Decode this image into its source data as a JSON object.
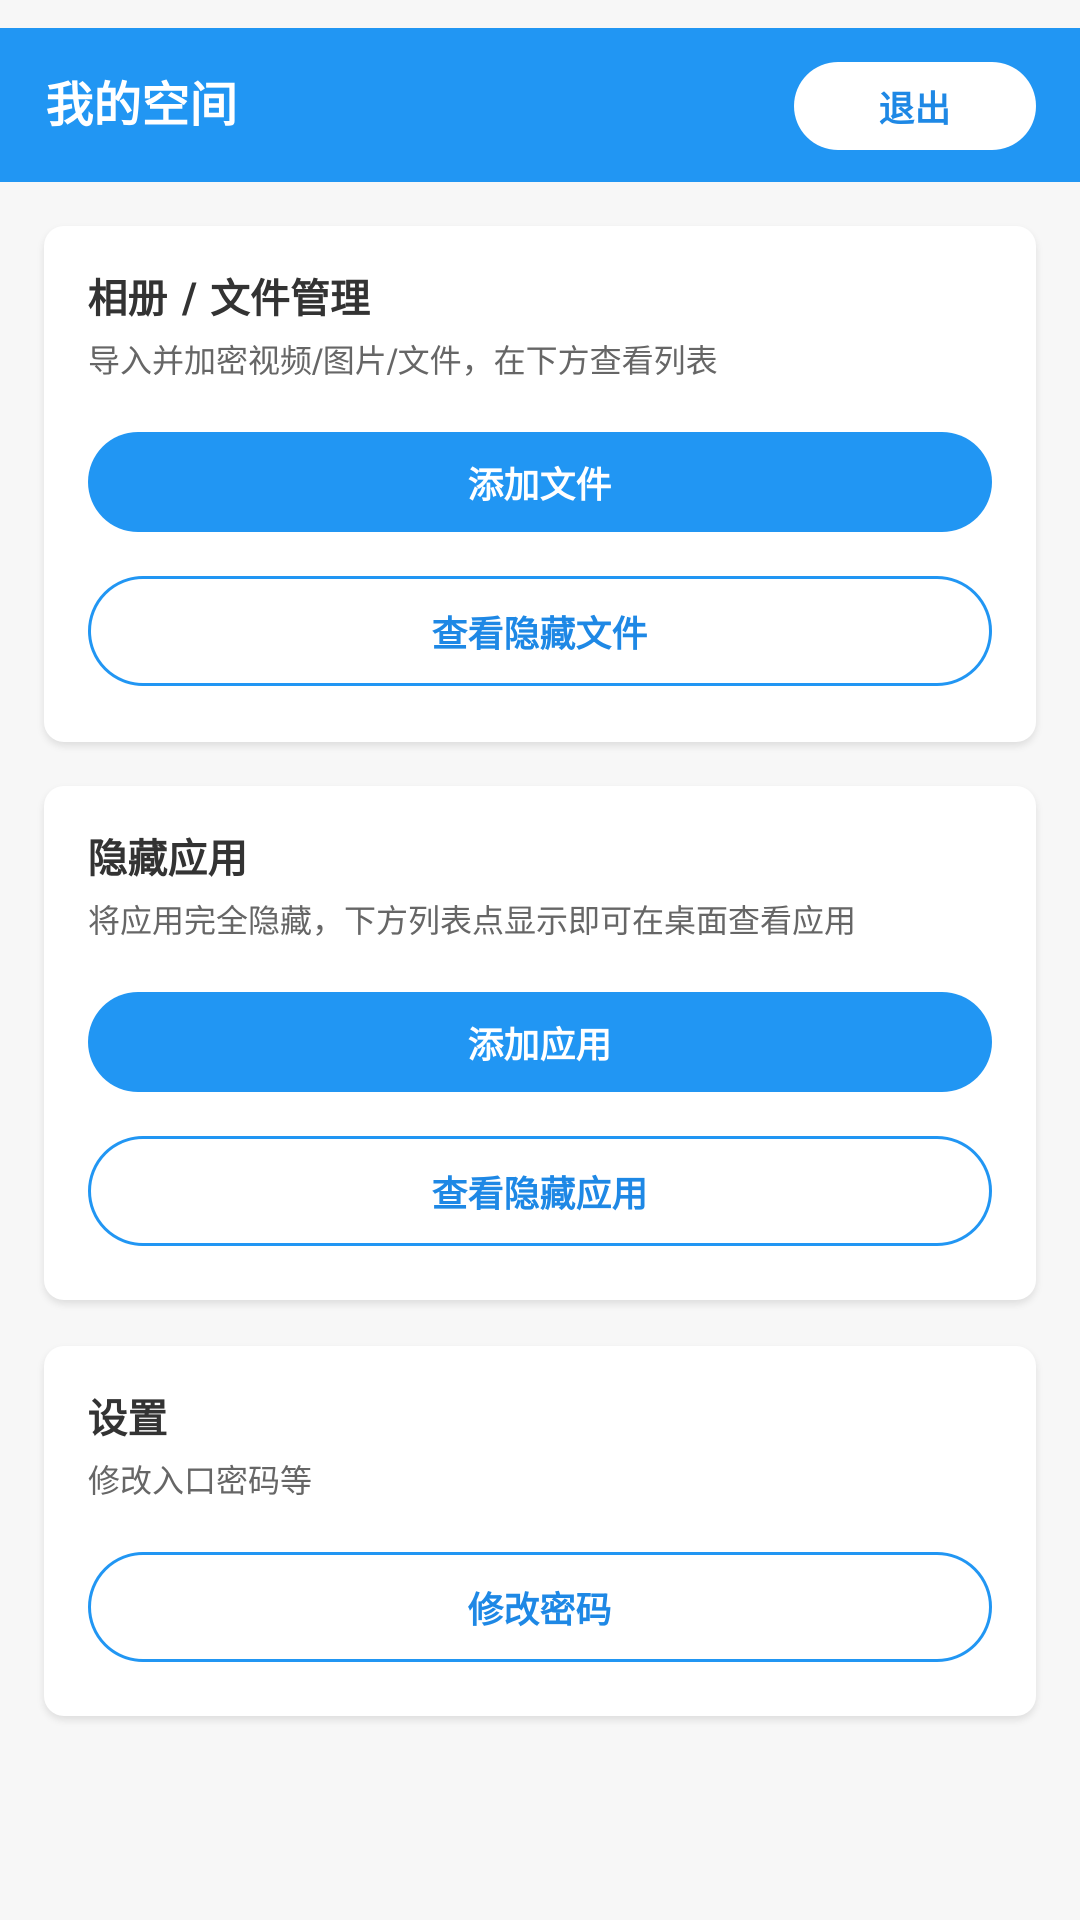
{
  "header": {
    "title": "我的空间",
    "logout_label": "退出",
    "color": "#2196f3"
  },
  "files_card": {
    "title": "相册 / 文件管理",
    "subtitle": "导入并加密视频/图片/文件，在下方查看列表",
    "add_label": "添加文件",
    "view_label": "查看隐藏文件"
  },
  "apps_card": {
    "title": "隐藏应用",
    "subtitle": "将应用完全隐藏，下方列表点显示即可在桌面查看应用",
    "add_label": "添加应用",
    "view_label": "查看隐藏应用"
  },
  "settings_card": {
    "title": "设置",
    "subtitle": "修改入口密码等",
    "change_password_label": "修改密码"
  }
}
